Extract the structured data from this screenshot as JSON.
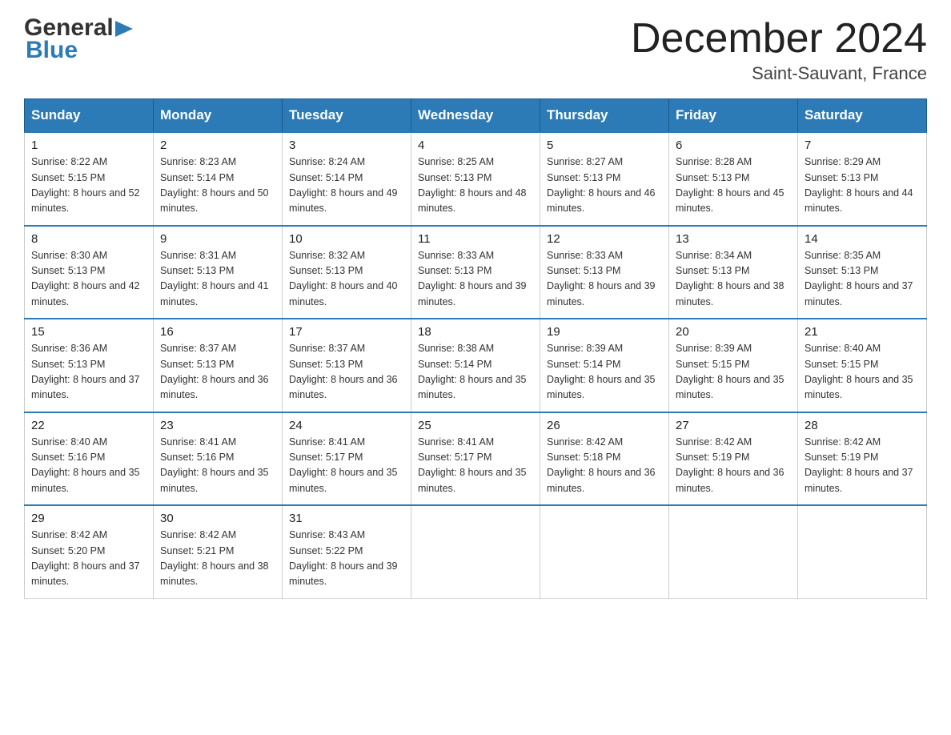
{
  "header": {
    "logo_line1": "General",
    "logo_arrow": "▶",
    "logo_line2": "Blue",
    "month_title": "December 2024",
    "location": "Saint-Sauvant, France"
  },
  "days_of_week": [
    "Sunday",
    "Monday",
    "Tuesday",
    "Wednesday",
    "Thursday",
    "Friday",
    "Saturday"
  ],
  "weeks": [
    [
      {
        "day": 1,
        "sunrise": "8:22 AM",
        "sunset": "5:15 PM",
        "daylight": "8 hours and 52 minutes."
      },
      {
        "day": 2,
        "sunrise": "8:23 AM",
        "sunset": "5:14 PM",
        "daylight": "8 hours and 50 minutes."
      },
      {
        "day": 3,
        "sunrise": "8:24 AM",
        "sunset": "5:14 PM",
        "daylight": "8 hours and 49 minutes."
      },
      {
        "day": 4,
        "sunrise": "8:25 AM",
        "sunset": "5:13 PM",
        "daylight": "8 hours and 48 minutes."
      },
      {
        "day": 5,
        "sunrise": "8:27 AM",
        "sunset": "5:13 PM",
        "daylight": "8 hours and 46 minutes."
      },
      {
        "day": 6,
        "sunrise": "8:28 AM",
        "sunset": "5:13 PM",
        "daylight": "8 hours and 45 minutes."
      },
      {
        "day": 7,
        "sunrise": "8:29 AM",
        "sunset": "5:13 PM",
        "daylight": "8 hours and 44 minutes."
      }
    ],
    [
      {
        "day": 8,
        "sunrise": "8:30 AM",
        "sunset": "5:13 PM",
        "daylight": "8 hours and 42 minutes."
      },
      {
        "day": 9,
        "sunrise": "8:31 AM",
        "sunset": "5:13 PM",
        "daylight": "8 hours and 41 minutes."
      },
      {
        "day": 10,
        "sunrise": "8:32 AM",
        "sunset": "5:13 PM",
        "daylight": "8 hours and 40 minutes."
      },
      {
        "day": 11,
        "sunrise": "8:33 AM",
        "sunset": "5:13 PM",
        "daylight": "8 hours and 39 minutes."
      },
      {
        "day": 12,
        "sunrise": "8:33 AM",
        "sunset": "5:13 PM",
        "daylight": "8 hours and 39 minutes."
      },
      {
        "day": 13,
        "sunrise": "8:34 AM",
        "sunset": "5:13 PM",
        "daylight": "8 hours and 38 minutes."
      },
      {
        "day": 14,
        "sunrise": "8:35 AM",
        "sunset": "5:13 PM",
        "daylight": "8 hours and 37 minutes."
      }
    ],
    [
      {
        "day": 15,
        "sunrise": "8:36 AM",
        "sunset": "5:13 PM",
        "daylight": "8 hours and 37 minutes."
      },
      {
        "day": 16,
        "sunrise": "8:37 AM",
        "sunset": "5:13 PM",
        "daylight": "8 hours and 36 minutes."
      },
      {
        "day": 17,
        "sunrise": "8:37 AM",
        "sunset": "5:13 PM",
        "daylight": "8 hours and 36 minutes."
      },
      {
        "day": 18,
        "sunrise": "8:38 AM",
        "sunset": "5:14 PM",
        "daylight": "8 hours and 35 minutes."
      },
      {
        "day": 19,
        "sunrise": "8:39 AM",
        "sunset": "5:14 PM",
        "daylight": "8 hours and 35 minutes."
      },
      {
        "day": 20,
        "sunrise": "8:39 AM",
        "sunset": "5:15 PM",
        "daylight": "8 hours and 35 minutes."
      },
      {
        "day": 21,
        "sunrise": "8:40 AM",
        "sunset": "5:15 PM",
        "daylight": "8 hours and 35 minutes."
      }
    ],
    [
      {
        "day": 22,
        "sunrise": "8:40 AM",
        "sunset": "5:16 PM",
        "daylight": "8 hours and 35 minutes."
      },
      {
        "day": 23,
        "sunrise": "8:41 AM",
        "sunset": "5:16 PM",
        "daylight": "8 hours and 35 minutes."
      },
      {
        "day": 24,
        "sunrise": "8:41 AM",
        "sunset": "5:17 PM",
        "daylight": "8 hours and 35 minutes."
      },
      {
        "day": 25,
        "sunrise": "8:41 AM",
        "sunset": "5:17 PM",
        "daylight": "8 hours and 35 minutes."
      },
      {
        "day": 26,
        "sunrise": "8:42 AM",
        "sunset": "5:18 PM",
        "daylight": "8 hours and 36 minutes."
      },
      {
        "day": 27,
        "sunrise": "8:42 AM",
        "sunset": "5:19 PM",
        "daylight": "8 hours and 36 minutes."
      },
      {
        "day": 28,
        "sunrise": "8:42 AM",
        "sunset": "5:19 PM",
        "daylight": "8 hours and 37 minutes."
      }
    ],
    [
      {
        "day": 29,
        "sunrise": "8:42 AM",
        "sunset": "5:20 PM",
        "daylight": "8 hours and 37 minutes."
      },
      {
        "day": 30,
        "sunrise": "8:42 AM",
        "sunset": "5:21 PM",
        "daylight": "8 hours and 38 minutes."
      },
      {
        "day": 31,
        "sunrise": "8:43 AM",
        "sunset": "5:22 PM",
        "daylight": "8 hours and 39 minutes."
      },
      null,
      null,
      null,
      null
    ]
  ]
}
